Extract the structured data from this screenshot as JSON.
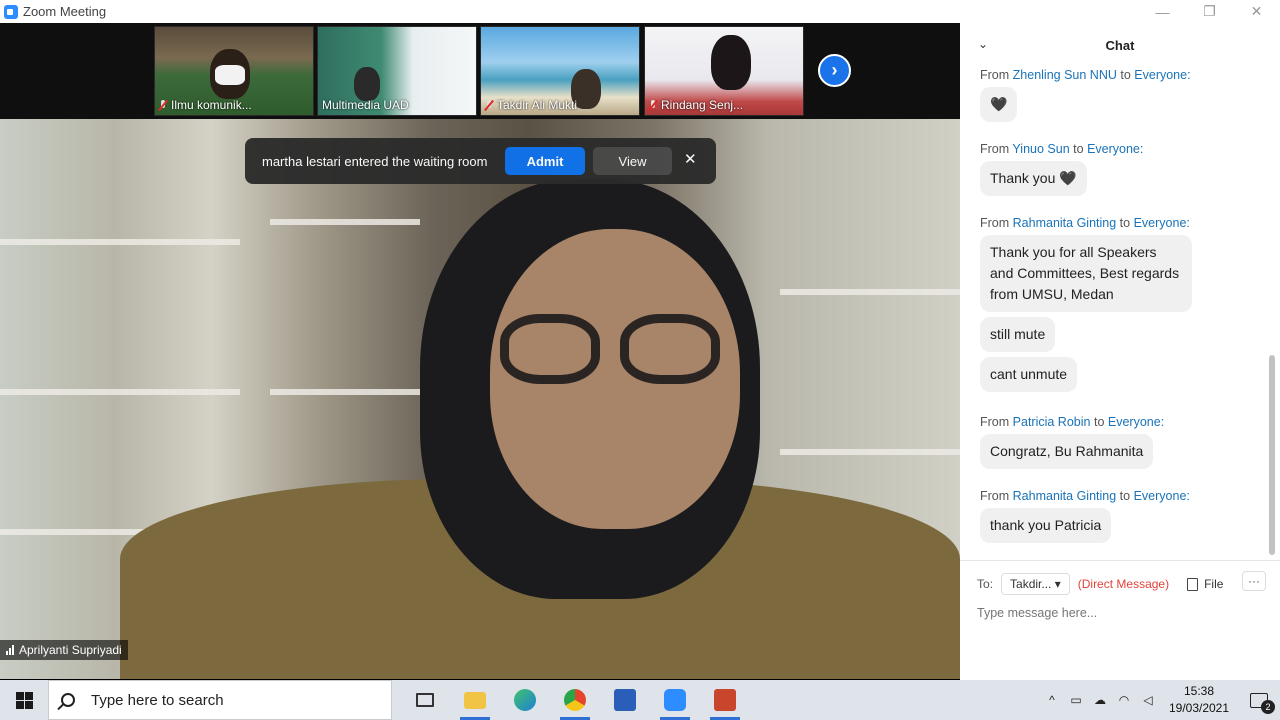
{
  "window": {
    "title": "Zoom Meeting",
    "minimize": "—",
    "restore": "❐",
    "close": "✕"
  },
  "thumbnails": [
    {
      "name": "Ilmu komunik...",
      "muted": true
    },
    {
      "name": "Multimedia UAD",
      "muted": false
    },
    {
      "name": "Takdir Ali Mukti",
      "muted": true
    },
    {
      "name": "Rindang Senj...",
      "muted": true
    }
  ],
  "next_arrow": "›",
  "main_video": {
    "speaker_name": "Aprilyanti Supriyadi"
  },
  "waiting_room": {
    "message": "martha lestari entered the waiting room",
    "admit_label": "Admit",
    "view_label": "View",
    "close": "✕"
  },
  "chat": {
    "title": "Chat",
    "collapse_glyph": "⌄",
    "messages": [
      {
        "from": "Zhenling Sun NNU",
        "to": "Everyone:",
        "texts": [
          "🖤"
        ]
      },
      {
        "from": "Yinuo Sun",
        "to": "Everyone:",
        "texts": [
          "Thank you 🖤"
        ]
      },
      {
        "from": "Rahmanita Ginting",
        "to": "Everyone:",
        "texts": [
          "Thank you for all Speakers and Committees, Best regards from UMSU, Medan",
          "still mute",
          "cant unmute"
        ]
      },
      {
        "from": "Patricia Robin",
        "to": "Everyone:",
        "texts": [
          "Congratz, Bu Rahmanita"
        ]
      },
      {
        "from": "Rahmanita Ginting",
        "to": "Everyone:",
        "texts": [
          "thank you Patricia"
        ]
      }
    ],
    "from_word": "From",
    "to_word": "to",
    "composer": {
      "to_label": "To:",
      "recipient": "Takdir...",
      "direct_message": "(Direct Message)",
      "file_label": "File",
      "more": "···",
      "placeholder": "Type message here..."
    }
  },
  "taskbar": {
    "search_placeholder": "Type here to search",
    "time": "15:38",
    "date": "19/03/2021",
    "notification_count": "2",
    "apps": [
      "task-view",
      "file-explorer",
      "edge",
      "chrome",
      "word",
      "zoom",
      "powerpoint"
    ]
  }
}
